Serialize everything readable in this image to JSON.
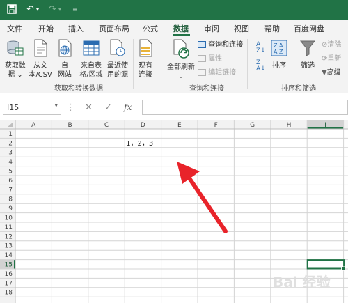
{
  "titlebar": {
    "save_icon": "save-icon",
    "undo_icon": "undo-icon",
    "redo_icon": "redo-icon",
    "customize_icon": "customize-qat-icon",
    "color": "#217346"
  },
  "tabs": [
    "文件",
    "开始",
    "插入",
    "页面布局",
    "公式",
    "数据",
    "审阅",
    "视图",
    "帮助",
    "百度网盘"
  ],
  "active_tab": "数据",
  "ribbon": {
    "get_data": [
      "获取数",
      "据 ⌄"
    ],
    "from_text": [
      "从文",
      "本/CSV"
    ],
    "from_web": [
      "自",
      "网站"
    ],
    "from_table": [
      "来自表",
      "格/区域"
    ],
    "recent": [
      "最近使",
      "用的源"
    ],
    "existing": [
      "现有",
      "连接"
    ],
    "group1_label": "获取和转换数据",
    "refresh_all": "全部刷新",
    "queries": "查询和连接",
    "properties": "属性",
    "edit_links": "编辑链接",
    "group2_label": "查询和连接",
    "sort_label": "排序",
    "filter_label": "筛选",
    "clear": "清除",
    "reapply": "重新",
    "advanced": "高级",
    "group3_label": "排序和筛选"
  },
  "formula_bar": {
    "name_box": "I15",
    "cancel_icon": "✕",
    "enter_icon": "✓",
    "fx": "fx",
    "content": ""
  },
  "sheet": {
    "columns": [
      "A",
      "B",
      "C",
      "D",
      "E",
      "F",
      "G",
      "H",
      "I"
    ],
    "rows": [
      "1",
      "2",
      "3",
      "4",
      "5",
      "6",
      "7",
      "8",
      "9",
      "10",
      "11",
      "12",
      "13",
      "14",
      "15",
      "16",
      "17",
      "18"
    ],
    "cells": [
      {
        "ref": "D2",
        "value": "1，2，3"
      }
    ],
    "selected_cell": "I15",
    "selected_row": "15",
    "selected_column": "I",
    "accent": "#217346"
  },
  "annotation": {
    "type": "red-arrow",
    "color": "#e8232a"
  },
  "watermark": "Bai 经验"
}
